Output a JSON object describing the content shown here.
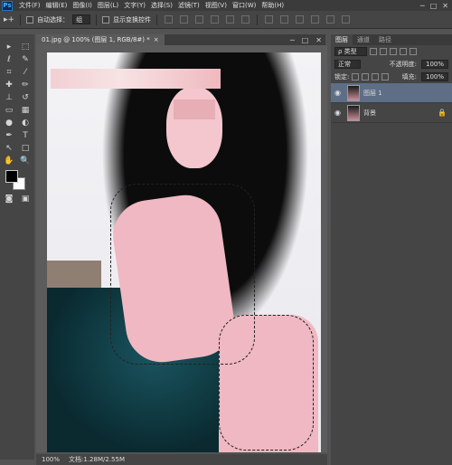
{
  "app": {
    "logo": "Ps"
  },
  "menu": [
    "文件(F)",
    "编辑(E)",
    "图像(I)",
    "图层(L)",
    "文字(Y)",
    "选择(S)",
    "滤镜(T)",
    "视图(V)",
    "窗口(W)",
    "帮助(H)"
  ],
  "window_controls": [
    "─",
    "□",
    "✕"
  ],
  "options": {
    "auto_select_label": "自动选择：",
    "auto_select_value": "组",
    "show_transform_label": "显示变换控件"
  },
  "document": {
    "tab_title": "01.jpg @ 100% (图层 1, RGB/8#) *",
    "close": "×",
    "zoom": "100%",
    "doc_size": "文档:1.28M/2.55M"
  },
  "layers_panel": {
    "tabs": [
      "图层",
      "通道",
      "路径"
    ],
    "filter_label": "ρ 类型",
    "blend_mode": "正常",
    "opacity_label": "不透明度:",
    "opacity_value": "100%",
    "lock_label": "锁定:",
    "fill_label": "填充:",
    "fill_value": "100%",
    "layers": [
      {
        "name": "图层 1",
        "selected": true,
        "locked": false
      },
      {
        "name": "背景",
        "selected": false,
        "locked": true
      }
    ]
  },
  "tool_icons": [
    "move-tool-icon",
    "marquee-tool-icon",
    "lasso-tool-icon",
    "quick-select-tool-icon",
    "crop-tool-icon",
    "eyedropper-tool-icon",
    "healing-brush-tool-icon",
    "brush-tool-icon",
    "clone-stamp-tool-icon",
    "history-brush-tool-icon",
    "eraser-tool-icon",
    "gradient-tool-icon",
    "blur-tool-icon",
    "dodge-tool-icon",
    "pen-tool-icon",
    "type-tool-icon",
    "path-select-tool-icon",
    "rectangle-tool-icon",
    "hand-tool-icon",
    "zoom-tool-icon"
  ],
  "colors": {
    "foreground": "#000000",
    "background": "#ffffff",
    "selected_layer": "#5e6e86"
  }
}
